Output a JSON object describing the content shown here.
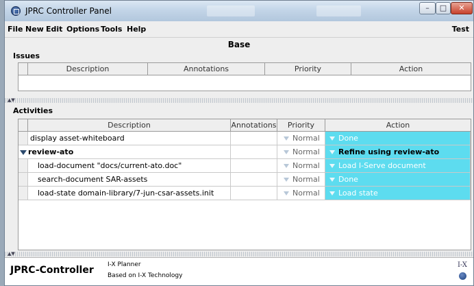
{
  "window": {
    "title": "JPRC Controller Panel",
    "controls": {
      "minimize": "–",
      "maximize": "□",
      "close": "✕"
    }
  },
  "menubar": {
    "items": [
      "File",
      "New",
      "Edit",
      "Options",
      "Tools",
      "Help"
    ],
    "right_label": "Test"
  },
  "base_label": "Base",
  "issues": {
    "title": "Issues",
    "columns": [
      "Description",
      "Annotations",
      "Priority",
      "Action"
    ]
  },
  "activities": {
    "title": "Activities",
    "columns": [
      "Description",
      "Annotations",
      "Priority",
      "Action"
    ],
    "rows": [
      {
        "description": "display asset-whiteboard",
        "annotations": "",
        "priority": "Normal",
        "action": "Done",
        "bold": false,
        "indent": false,
        "expandable": false
      },
      {
        "description": "review-ato",
        "annotations": "",
        "priority": "Normal",
        "action": "Refine using review-ato",
        "bold": true,
        "indent": false,
        "expandable": true
      },
      {
        "description": "load-document \"docs/current-ato.doc\"",
        "annotations": "",
        "priority": "Normal",
        "action": "Load I-Serve document",
        "bold": false,
        "indent": true,
        "expandable": false
      },
      {
        "description": "search-document SAR-assets",
        "annotations": "",
        "priority": "Normal",
        "action": "Done",
        "bold": false,
        "indent": true,
        "expandable": false
      },
      {
        "description": "load-state domain-library/7-jun-csar-assets.init",
        "annotations": "",
        "priority": "Normal",
        "action": "Load state",
        "bold": false,
        "indent": true,
        "expandable": false
      }
    ]
  },
  "footer": {
    "name": "JPRC-Controller",
    "line1": "I-X Planner",
    "line2": "Based on I-X Technology",
    "logo_text": "I-X"
  },
  "colors": {
    "action_cell": "#5ddcef",
    "titlebar": "#c3d5e8"
  }
}
